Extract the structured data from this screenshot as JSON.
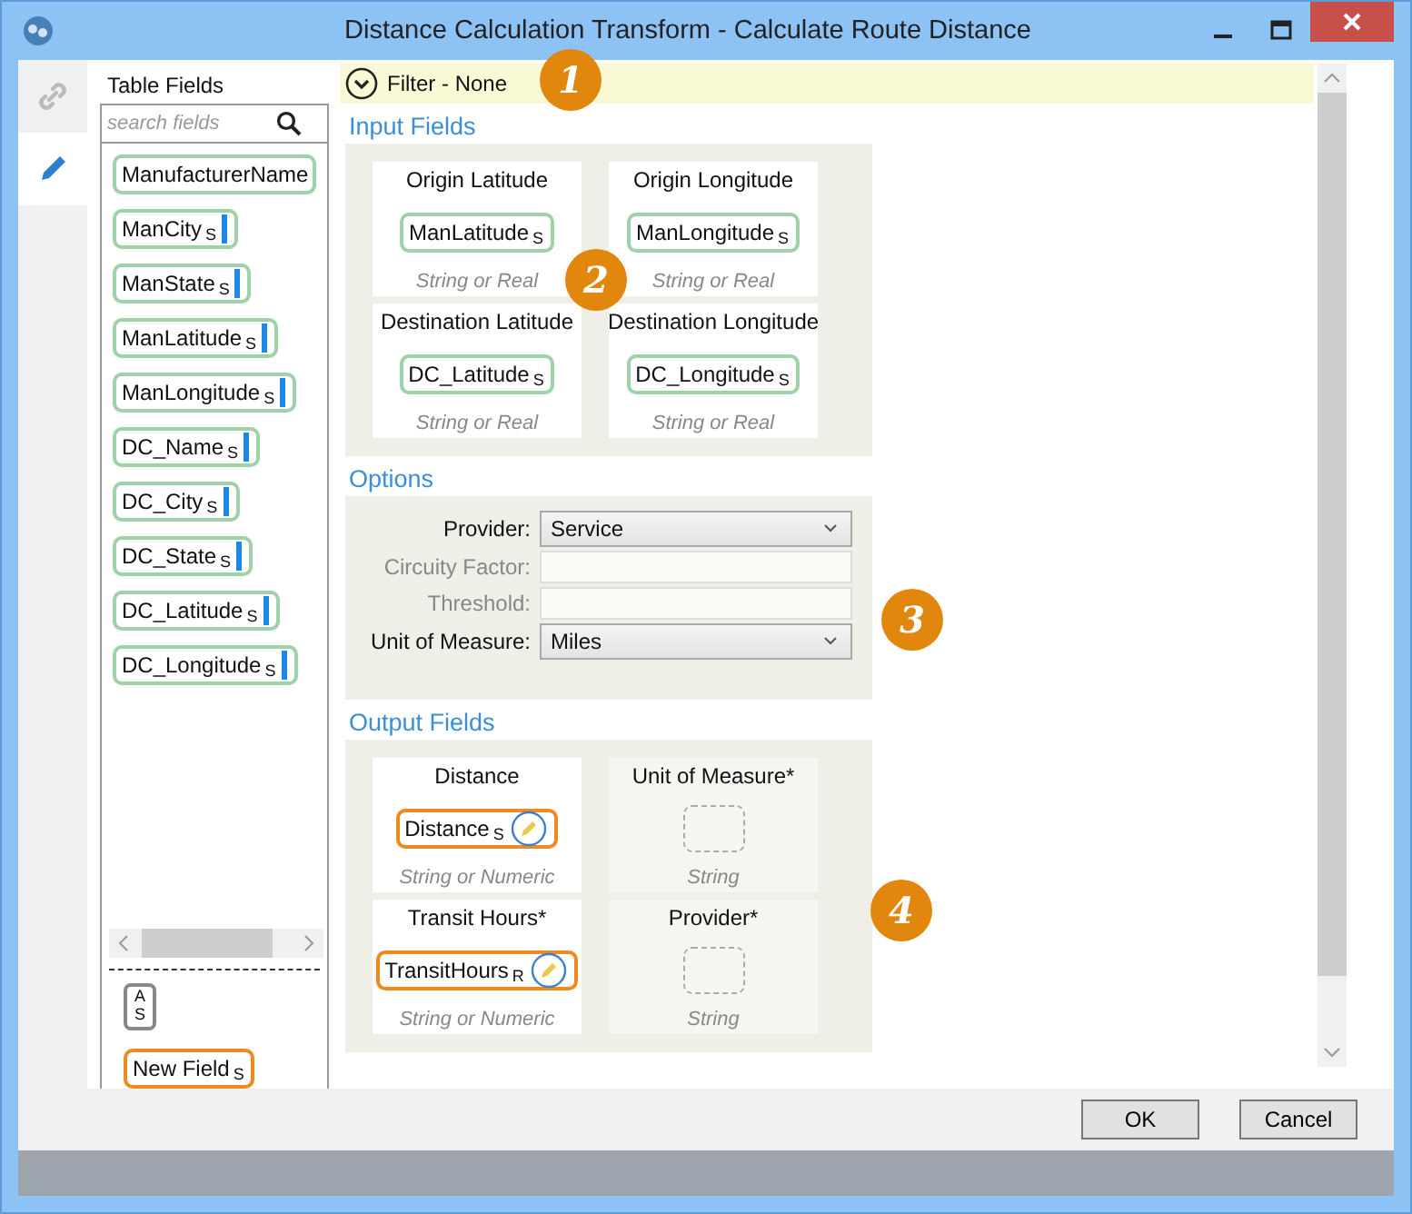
{
  "window": {
    "title": "Distance Calculation Transform - Calculate Route Distance"
  },
  "side_tabs": [
    {
      "kind": "link",
      "selected": false
    },
    {
      "kind": "edit",
      "selected": true
    }
  ],
  "table_fields": {
    "title": "Table Fields",
    "search": {
      "placeholder": "search fields"
    },
    "fields": [
      {
        "name": "ManufacturerName"
      },
      {
        "name": "ManCity",
        "type": "S"
      },
      {
        "name": "ManState",
        "type": "S"
      },
      {
        "name": "ManLatitude",
        "type": "S"
      },
      {
        "name": "ManLongitude",
        "type": "S"
      },
      {
        "name": "DC_Name",
        "type": "S"
      },
      {
        "name": "DC_City",
        "type": "S"
      },
      {
        "name": "DC_State",
        "type": "S"
      },
      {
        "name": "DC_Latitude",
        "type": "S"
      },
      {
        "name": "DC_Longitude",
        "type": "S"
      }
    ],
    "type_chip": [
      "A",
      "S"
    ],
    "new_field": {
      "name": "New Field",
      "type": "S"
    }
  },
  "filter": {
    "label": "Filter - None",
    "expanded": false
  },
  "input_fields": {
    "title": "Input Fields",
    "slots": [
      {
        "label": "Origin Latitude",
        "field": "ManLatitude",
        "type": "S",
        "hint": "String or Real"
      },
      {
        "label": "Origin Longitude",
        "field": "ManLongitude",
        "type": "S",
        "hint": "String or Real"
      },
      {
        "label": "Destination Latitude",
        "field": "DC_Latitude",
        "type": "S",
        "hint": "String or Real"
      },
      {
        "label": "Destination Longitude",
        "field": "DC_Longitude",
        "type": "S",
        "hint": "String or Real"
      }
    ]
  },
  "options": {
    "title": "Options",
    "rows": [
      {
        "kind": "select",
        "label": "Provider:",
        "value": "Service",
        "disabled": false
      },
      {
        "kind": "text",
        "label": "Circuity Factor:",
        "disabled": true
      },
      {
        "kind": "text",
        "label": "Threshold:",
        "disabled": true
      },
      {
        "kind": "select",
        "label": "Unit of Measure:",
        "value": "Miles",
        "disabled": false
      }
    ]
  },
  "output_fields": {
    "title": "Output Fields",
    "slots": [
      {
        "label": "Distance",
        "field": "Distance",
        "type": "S",
        "hint": "String or Numeric"
      },
      {
        "label": "Unit of Measure*",
        "hint": "String"
      },
      {
        "label": "Transit Hours*",
        "field": "TransitHours",
        "type": "R",
        "hint": "String or Numeric"
      },
      {
        "label": "Provider*",
        "hint": "String"
      }
    ]
  },
  "callouts": [
    "1",
    "2",
    "3",
    "4"
  ],
  "buttons": [
    "OK",
    "Cancel"
  ]
}
